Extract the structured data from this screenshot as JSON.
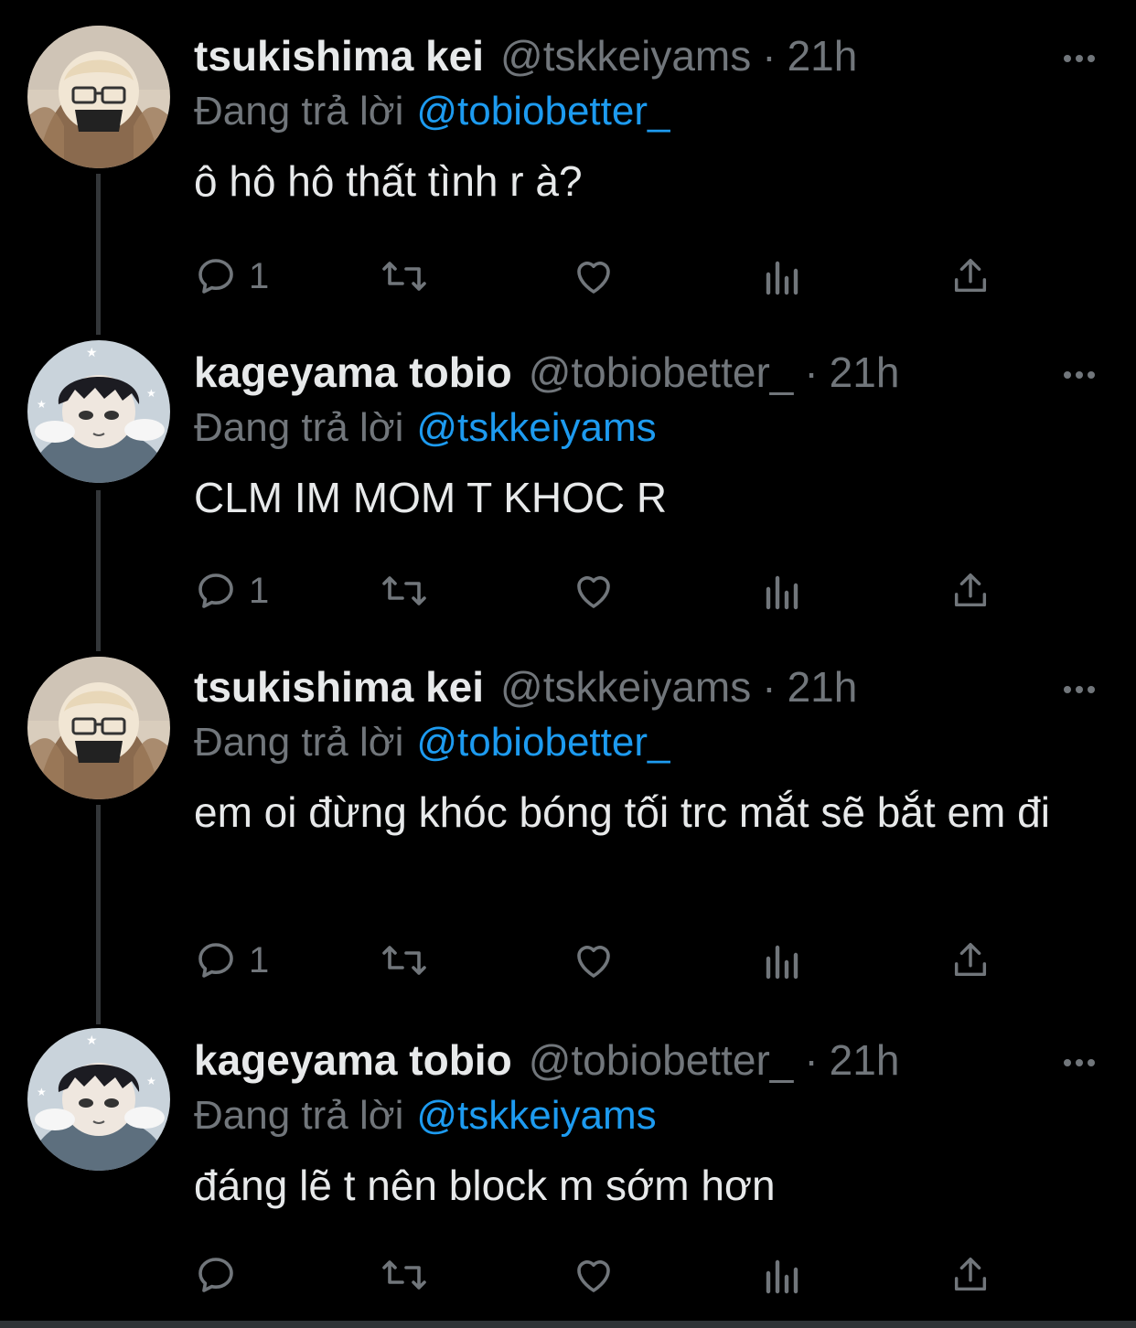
{
  "tweets": [
    {
      "name": "tsukishima kei",
      "handle": "@tskkeiyams",
      "separator": "·",
      "time": "21h",
      "reply_prefix": "Đang trả lời",
      "reply_to": "@tobiobetter_",
      "text": "ô hô hô thất tình r à?",
      "reply_count": "1",
      "avatar": "tsukishima-avatar"
    },
    {
      "name": "kageyama tobio",
      "handle": "@tobiobetter_",
      "separator": "·",
      "time": "21h",
      "reply_prefix": "Đang trả lời",
      "reply_to": "@tskkeiyams",
      "text": "CLM IM MOM T KHOC R",
      "reply_count": "1",
      "avatar": "kageyama-avatar"
    },
    {
      "name": "tsukishima kei",
      "handle": "@tskkeiyams",
      "separator": "·",
      "time": "21h",
      "reply_prefix": "Đang trả lời",
      "reply_to": "@tobiobetter_",
      "text": "em oi đừng khóc bóng tối trc mắt sẽ bắt em đi",
      "reply_count": "1",
      "avatar": "tsukishima-avatar"
    },
    {
      "name": "kageyama tobio",
      "handle": "@tobiobetter_",
      "separator": "·",
      "time": "21h",
      "reply_prefix": "Đang trả lời",
      "reply_to": "@tskkeiyams",
      "text": "đáng lẽ t nên block m sớm hơn",
      "reply_count": "",
      "avatar": "kageyama-avatar"
    }
  ],
  "icons": {
    "reply": "reply-icon",
    "retweet": "retweet-icon",
    "like": "heart-icon",
    "views": "views-icon",
    "share": "share-icon",
    "more": "more-icon"
  },
  "colors": {
    "background": "#000000",
    "text": "#e7e9ea",
    "muted": "#71767b",
    "link": "#1d9bf0",
    "thread_line": "#333639"
  }
}
